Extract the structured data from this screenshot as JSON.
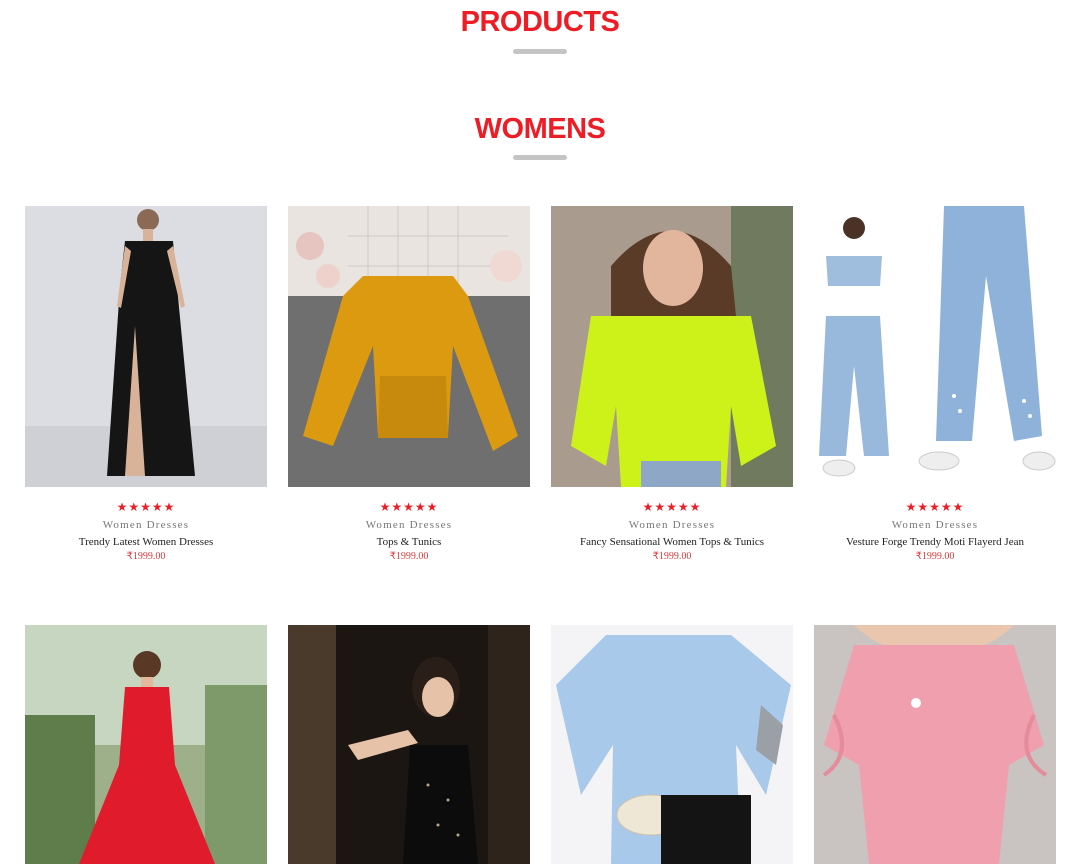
{
  "headings": {
    "products": "PRODUCTS",
    "womens": "WOMENS"
  },
  "colors": {
    "accent": "#ee1c25",
    "divider": "#c4c4c4",
    "price": "#d83b3b"
  },
  "products": [
    {
      "rating": 5,
      "stars": "★★★★★",
      "category": "Women Dresses",
      "name": "Trendy Latest Women Dresses",
      "price": "₹1999.00",
      "image": "black-maxi-dress-photo"
    },
    {
      "rating": 5,
      "stars": "★★★★★",
      "category": "Women Dresses",
      "name": "Tops & Tunics",
      "price": "₹1999.00",
      "image": "mustard-crop-top-photo"
    },
    {
      "rating": 5,
      "stars": "★★★★★",
      "category": "Women Dresses",
      "name": "Fancy Sensational Women Tops & Tunics",
      "price": "₹1999.00",
      "image": "neon-yellow-top-photo"
    },
    {
      "rating": 5,
      "stars": "★★★★★",
      "category": "Women Dresses",
      "name": "Vesture Forge Trendy Moti Flayerd Jean",
      "price": "₹1999.00",
      "image": "denim-jeans-photo"
    },
    {
      "image": "red-tiered-dress-photo"
    },
    {
      "image": "black-sequin-dress-photo"
    },
    {
      "image": "blue-knit-top-photo"
    },
    {
      "image": "pink-ruffle-top-photo"
    }
  ]
}
